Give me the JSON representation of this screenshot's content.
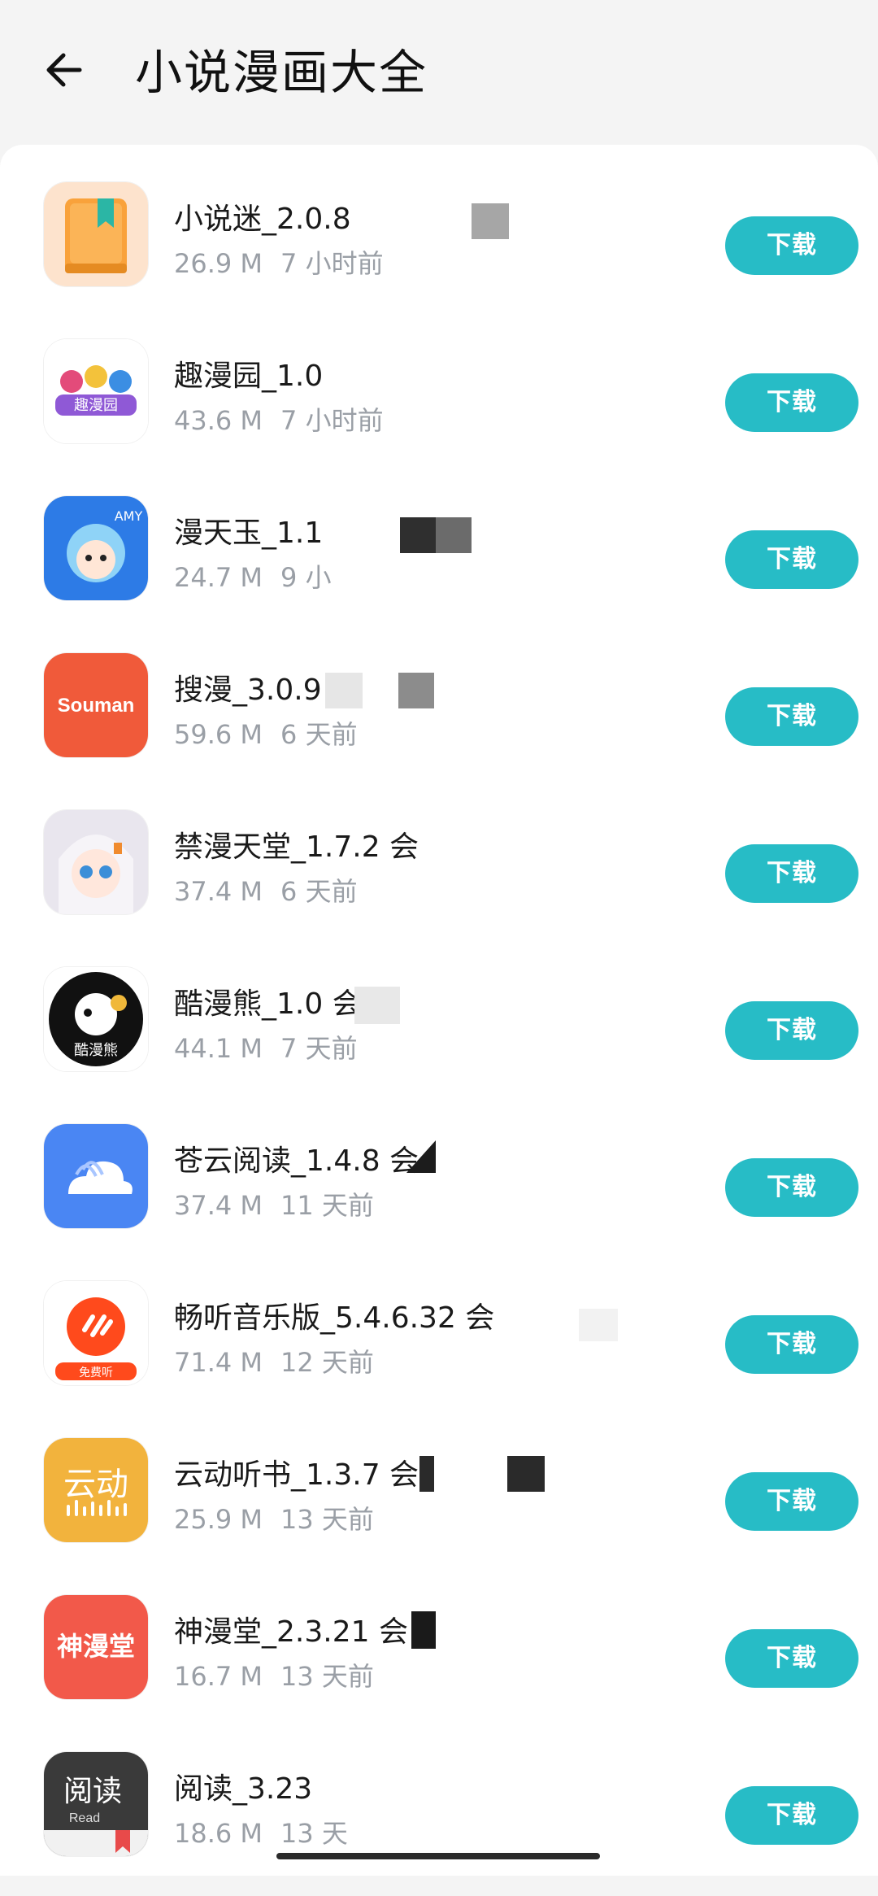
{
  "header": {
    "back_icon": "arrow-left-icon",
    "title": "小说漫画大全"
  },
  "apps": [
    {
      "name": "小说迷_2.0.8",
      "size": "26.9 M",
      "time": "7 小时前",
      "button": "下载",
      "icon": "book-icon",
      "color": "#f9a23b"
    },
    {
      "name": "趣漫园_1.0",
      "size": "43.6 M",
      "time": "7 小时前",
      "button": "下载",
      "icon": "comic-logo-icon",
      "color": "#ffffff"
    },
    {
      "name": "漫天玉_1.1",
      "size": "24.7 M",
      "time": "9 小",
      "button": "下载",
      "icon": "anime-girl-icon",
      "color": "#2d7be6"
    },
    {
      "name": "搜漫_3.0.9",
      "size": "59.6 M",
      "time": "6 天前",
      "button": "下载",
      "icon": "souman-logo-icon",
      "icon_text": "Souman",
      "color": "#f05a3a"
    },
    {
      "name": "禁漫天堂_1.7.2 会",
      "size": "37.4 M",
      "time": "6 天前",
      "button": "下载",
      "icon": "anime-girl-icon",
      "color": "#e9e6ee"
    },
    {
      "name": "酷漫熊_1.0 会",
      "size": "44.1 M",
      "time": "7 天前",
      "button": "下载",
      "icon": "bear-logo-icon",
      "color": "#111111"
    },
    {
      "name": "苍云阅读_1.4.8 会",
      "size": "37.4 M",
      "time": "11 天前",
      "button": "下载",
      "icon": "cloud-book-icon",
      "color": "#4a86f3"
    },
    {
      "name": "畅听音乐版_5.4.6.32 会",
      "size": "71.4 M",
      "time": "12 天前",
      "button": "下载",
      "icon": "music-logo-icon",
      "icon_text": "免费听",
      "color": "#ff4a1c"
    },
    {
      "name": "云动听书_1.3.7 会",
      "size": "25.9 M",
      "time": "13 天前",
      "button": "下载",
      "icon": "yundong-logo-icon",
      "icon_text": "云动",
      "color": "#f2b33d"
    },
    {
      "name": "神漫堂_2.3.21 会",
      "size": "16.7 M",
      "time": "13 天前",
      "button": "下载",
      "icon": "shenmantang-logo-icon",
      "icon_text": "神漫堂",
      "color": "#f2594a"
    },
    {
      "name": "阅读_3.23",
      "size": "18.6 M",
      "time": "13 天",
      "button": "下载",
      "icon": "read-logo-icon",
      "icon_text": "阅读",
      "icon_subtext": "Read",
      "color": "#3a3a3a"
    }
  ],
  "colors": {
    "accent": "#27bcc6",
    "meta_text": "#9a9fa6",
    "background": "#f4f4f4"
  }
}
